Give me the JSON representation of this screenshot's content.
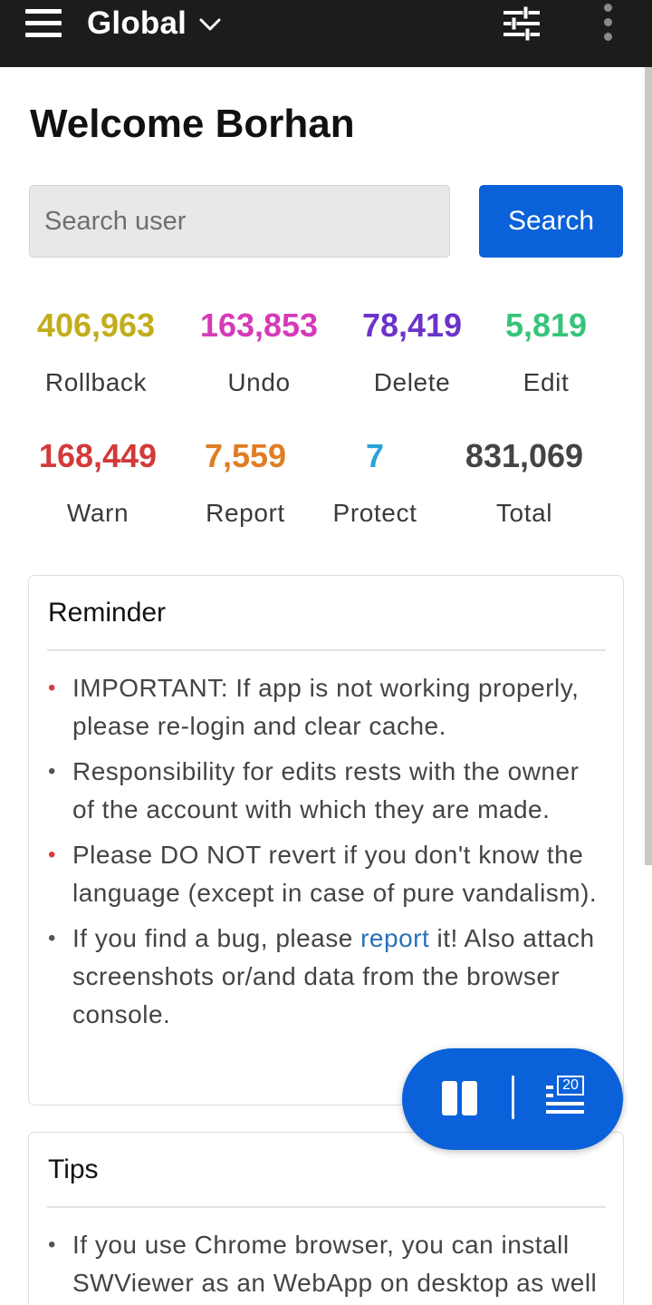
{
  "header": {
    "project": "Global",
    "icons": {
      "menu": "hamburger-icon",
      "dropdown": "chevron-down-icon",
      "filter": "sliders-icon",
      "more": "more-vertical-icon"
    }
  },
  "welcome": "Welcome Borhan",
  "search": {
    "placeholder": "Search user",
    "button": "Search"
  },
  "stats": [
    {
      "value": "406,963",
      "label": "Rollback",
      "color": "#c2ad1b"
    },
    {
      "value": "163,853",
      "label": "Undo",
      "color": "#d43bb8"
    },
    {
      "value": "78,419",
      "label": "Delete",
      "color": "#6b34c9"
    },
    {
      "value": "5,819",
      "label": "Edit",
      "color": "#37c47a"
    },
    {
      "value": "168,449",
      "label": "Warn",
      "color": "#d33a3a"
    },
    {
      "value": "7,559",
      "label": "Report",
      "color": "#e07d23"
    },
    {
      "value": "7",
      "label": "Protect",
      "color": "#2aa3d9"
    },
    {
      "value": "831,069",
      "label": "Total",
      "color": "#444444"
    }
  ],
  "reminder": {
    "title": "Reminder",
    "items": [
      {
        "text": "IMPORTANT: If app is not working properly, please re-login and clear cache.",
        "bullet_color": "#d93a3a"
      },
      {
        "text": "Responsibility for edits rests with the owner of the account with which they are made.",
        "bullet_color": "#555555"
      },
      {
        "text": "Please DO NOT revert if you don't know the language (except in case of pure vandalism).",
        "bullet_color": "#d93a3a"
      },
      {
        "text_before": "If you find a bug, please ",
        "link": "report",
        "text_after": " it! Also attach screenshots or/and data from the browser console.",
        "bullet_color": "#555555"
      }
    ]
  },
  "tips": {
    "title": "Tips",
    "items": [
      {
        "text": "If you use Chrome browser, you can install SWViewer as an WebApp on desktop as well"
      }
    ]
  },
  "floating_controls": {
    "queue_count": "20",
    "icons": {
      "pause": "pause-icon",
      "queue": "queue-list-icon"
    }
  }
}
